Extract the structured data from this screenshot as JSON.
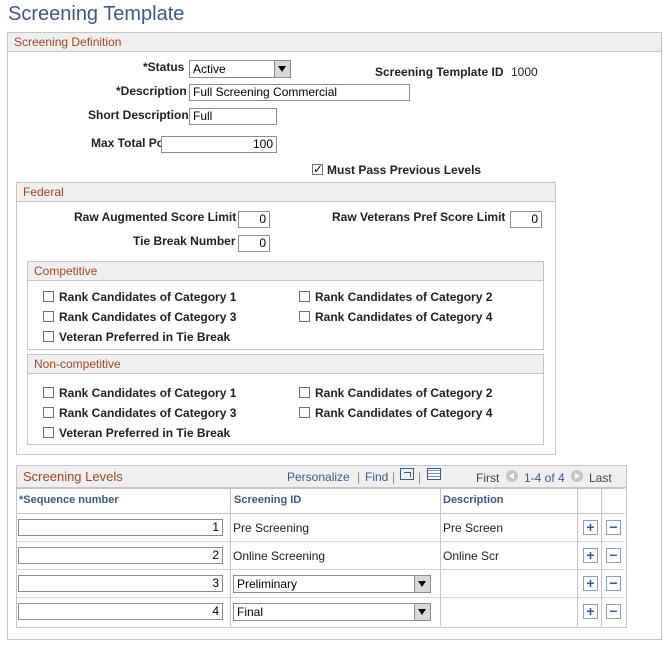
{
  "page_title": "Screening Template",
  "definition": {
    "section_title": "Screening Definition",
    "status_label": "*Status",
    "status_value": "Active",
    "template_id_label": "Screening Template ID",
    "template_id_value": "1000",
    "description_label": "*Description",
    "description_value": "Full Screening Commercial",
    "short_desc_label": "Short Description",
    "short_desc_value": "Full",
    "max_points_label": "Max Total Points",
    "max_points_value": "100",
    "must_pass_label": "Must Pass Previous Levels",
    "must_pass_checked": true
  },
  "federal": {
    "section_title": "Federal",
    "raw_aug_label": "Raw Augmented Score Limit",
    "raw_aug_value": "0",
    "raw_vet_label": "Raw Veterans Pref Score Limit",
    "raw_vet_value": "0",
    "tie_break_label": "Tie Break Number",
    "tie_break_value": "0",
    "competitive": {
      "section_title": "Competitive",
      "cat1": "Rank Candidates of Category 1",
      "cat2": "Rank Candidates of Category 2",
      "cat3": "Rank Candidates of Category 3",
      "cat4": "Rank Candidates of Category 4",
      "veteran": "Veteran Preferred in Tie Break"
    },
    "noncompetitive": {
      "section_title": "Non-competitive",
      "cat1": "Rank Candidates of Category 1",
      "cat2": "Rank Candidates of Category 2",
      "cat3": "Rank Candidates of Category 3",
      "cat4": "Rank Candidates of Category 4",
      "veteran": "Veteran Preferred in Tie Break"
    }
  },
  "levels": {
    "section_title": "Screening Levels",
    "personalize": "Personalize",
    "find": "Find",
    "separator": "|",
    "first": "First",
    "range": "1-4 of 4",
    "last": "Last",
    "columns": {
      "sequence": "*Sequence number",
      "screening_id": "Screening ID",
      "description": "Description"
    },
    "rows": [
      {
        "sequence": "1",
        "screening_id": "Pre Screening",
        "description": "Pre Screen"
      },
      {
        "sequence": "2",
        "screening_id": "Online Screening",
        "description": "Online Scr"
      },
      {
        "sequence": "3",
        "screening_id": "Preliminary",
        "description": ""
      },
      {
        "sequence": "4",
        "screening_id": "Final",
        "description": ""
      }
    ],
    "add_symbol": "+",
    "remove_symbol": "−"
  }
}
